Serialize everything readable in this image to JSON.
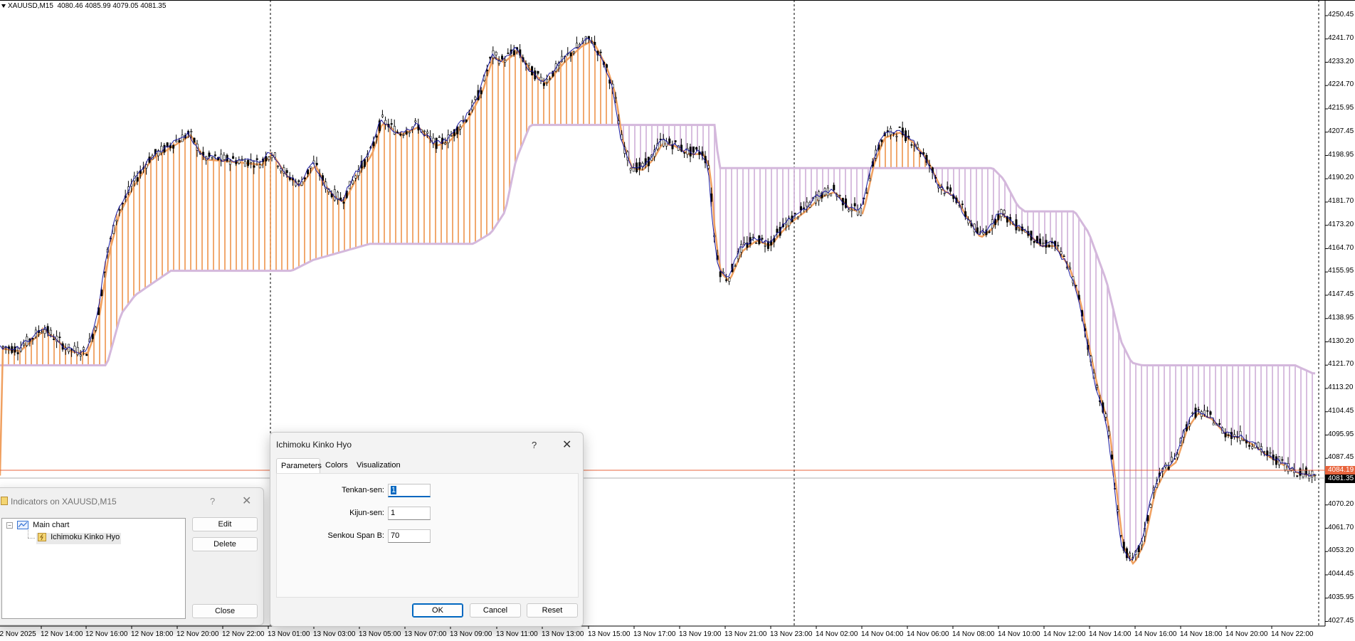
{
  "chart": {
    "symbol_text": "XAUUSD,M15",
    "ohlc_text": "4080.46 4085.99 4079.05 4081.35",
    "price_ticks": [
      "4250.45",
      "4241.70",
      "4233.20",
      "4224.70",
      "4215.95",
      "4207.45",
      "4198.95",
      "4190.20",
      "4181.70",
      "4173.20",
      "4164.70",
      "4155.95",
      "4147.45",
      "4138.95",
      "4130.20",
      "4121.70",
      "4113.20",
      "4104.45",
      "4095.95",
      "4087.45",
      "4078.70",
      "4070.20",
      "4061.70",
      "4053.20",
      "4044.45",
      "4035.95",
      "4027.45"
    ],
    "price_tag_red": "4084.19",
    "price_tag_black": "4081.35",
    "time_ticks": [
      "12 Nov 2025",
      "12 Nov 14:00",
      "12 Nov 16:00",
      "12 Nov 18:00",
      "12 Nov 20:00",
      "12 Nov 22:00",
      "13 Nov 01:00",
      "13 Nov 03:00",
      "13 Nov 05:00",
      "13 Nov 07:00",
      "13 Nov 09:00",
      "13 Nov 11:00",
      "13 Nov 13:00",
      "13 Nov 15:00",
      "13 Nov 17:00",
      "13 Nov 19:00",
      "13 Nov 21:00",
      "13 Nov 23:00",
      "14 Nov 02:00",
      "14 Nov 04:00",
      "14 Nov 06:00",
      "14 Nov 08:00",
      "14 Nov 10:00",
      "14 Nov 12:00",
      "14 Nov 14:00",
      "14 Nov 16:00",
      "14 Nov 18:00",
      "14 Nov 20:00",
      "14 Nov 22:00"
    ],
    "colors": {
      "candle": "#000000",
      "tenkan": "#1a1aa0",
      "kijun": "#f0a060",
      "cloud_up": "#f0a060",
      "cloud_down": "#d4b8dc",
      "span_b": "#d4b8dc",
      "bid_line": "#e8643c",
      "ask_line": "#b0b0b0"
    }
  },
  "indicators_dialog": {
    "title": "Indicators on XAUUSD,M15",
    "help_icon": "?",
    "close_icon": "✕",
    "tree": {
      "root_label": "Main chart",
      "child_label": "Ichimoku Kinko Hyo"
    },
    "buttons": {
      "edit": "Edit",
      "delete": "Delete",
      "close": "Close"
    }
  },
  "ichimoku_dialog": {
    "title": "Ichimoku Kinko Hyo",
    "help_icon": "?",
    "close_icon": "✕",
    "tabs": [
      "Parameters",
      "Colors",
      "Visualization"
    ],
    "active_tab": "Parameters",
    "params": {
      "tenkan_label": "Tenkan-sen:",
      "tenkan_value": "1",
      "kijun_label": "Kijun-sen:",
      "kijun_value": "1",
      "senkou_label": "Senkou Span B:",
      "senkou_value": "70"
    },
    "buttons": {
      "ok": "OK",
      "cancel": "Cancel",
      "reset": "Reset"
    }
  }
}
